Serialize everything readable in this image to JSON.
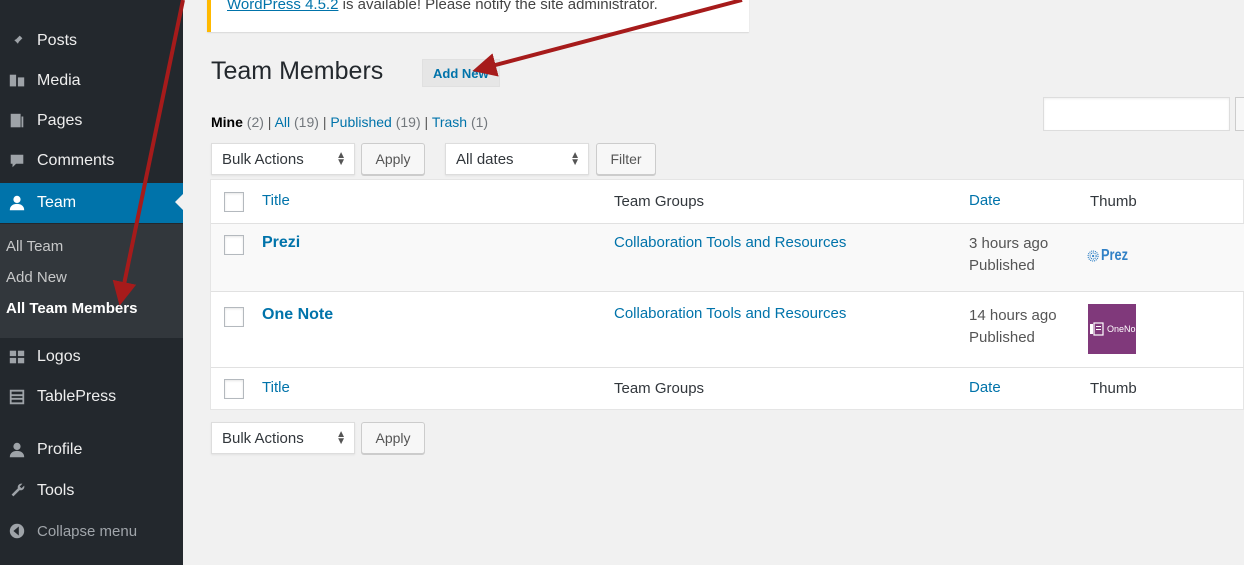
{
  "sidebar": {
    "items": [
      {
        "label": "Posts",
        "icon": "pin-icon"
      },
      {
        "label": "Media",
        "icon": "media-icon"
      },
      {
        "label": "Pages",
        "icon": "pages-icon"
      },
      {
        "label": "Comments",
        "icon": "comments-icon"
      },
      {
        "label": "Team",
        "icon": "user-icon"
      },
      {
        "label": "Logos",
        "icon": "grid-icon"
      },
      {
        "label": "TablePress",
        "icon": "table-icon"
      },
      {
        "label": "Profile",
        "icon": "user-icon"
      },
      {
        "label": "Tools",
        "icon": "wrench-icon"
      }
    ],
    "submenu": [
      "All Team",
      "Add New",
      "All Team Members"
    ],
    "collapse_label": "Collapse menu"
  },
  "notice": {
    "link_text": "WordPress 4.5.2",
    "text": " is available! Please notify the site administrator."
  },
  "header": {
    "title": "Team Members",
    "add_new": "Add New"
  },
  "views": {
    "mine": "Mine",
    "mine_count": "(2)",
    "all": "All",
    "all_count": "(19)",
    "published": "Published",
    "published_count": "(19)",
    "trash": "Trash",
    "trash_count": "(1)",
    "sep": "|"
  },
  "toolbar_top": {
    "bulk_actions": "Bulk Actions",
    "apply": "Apply",
    "dates": "All dates",
    "filter": "Filter"
  },
  "toolbar_bottom": {
    "bulk_actions": "Bulk Actions",
    "apply": "Apply"
  },
  "table": {
    "columns": {
      "title": "Title",
      "groups": "Team Groups",
      "date": "Date",
      "thumb": "Thumb"
    },
    "rows": [
      {
        "title": "Prezi",
        "group": "Collaboration Tools and Resources",
        "date": "3 hours ago",
        "status": "Published",
        "thumb_text": "Prez"
      },
      {
        "title": "One Note",
        "group": "Collaboration Tools and Resources",
        "date": "14 hours ago",
        "status": "Published",
        "thumb_text": "OneNo"
      }
    ]
  },
  "colors": {
    "sidebar_bg": "#23282d",
    "active_bg": "#0073aa",
    "link": "#0073aa",
    "annotation_arrow": "#a61b1b"
  }
}
